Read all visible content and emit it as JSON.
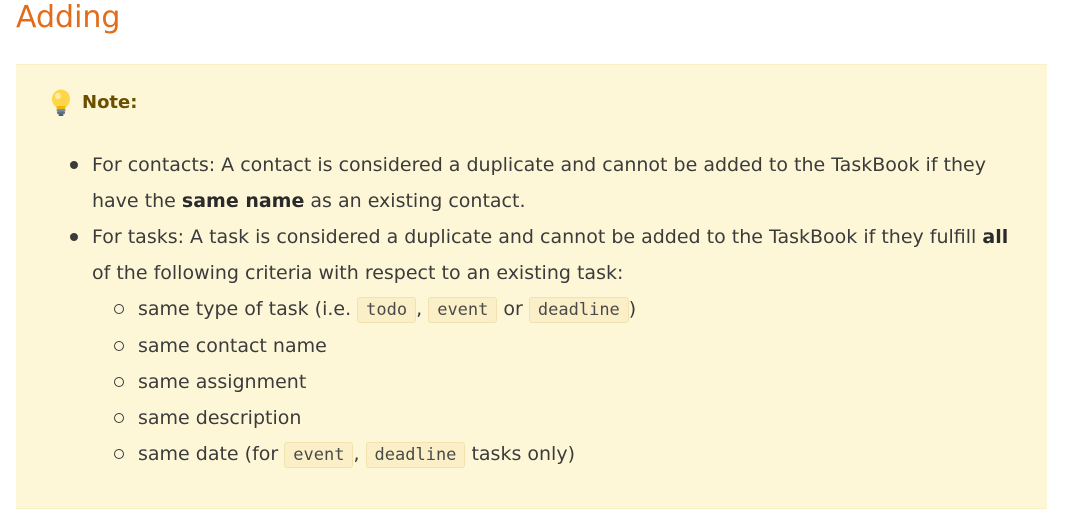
{
  "heading": "Adding",
  "note": {
    "icon": "lightbulb-icon",
    "title": "Note:",
    "colors": {
      "heading": "#e36c1b",
      "box_background": "#fef7d7",
      "code_background": "#fbefc7"
    }
  },
  "items": [
    {
      "text_before": "For contacts: A contact is considered a duplicate and cannot be added to the TaskBook if they have the ",
      "bold": "same name",
      "text_after": " as an existing contact."
    },
    {
      "text_before": "For tasks: A task is considered a duplicate and cannot be added to the TaskBook if they fulfill ",
      "bold": "all",
      "text_after": " of the following criteria with respect to an existing task:",
      "sub": {
        "type_prefix": "same type of task (i.e. ",
        "code_todo": "todo",
        "sep1": ",",
        "code_event": "event",
        "or": " or ",
        "code_deadline": "deadline",
        "type_suffix": ")",
        "contact_name": "same contact name",
        "assignment": "same assignment",
        "description": "same description",
        "date_prefix": "same date (for ",
        "date_code_event": "event",
        "date_sep": ",",
        "date_code_deadline": "deadline",
        "date_suffix": " tasks only)"
      }
    }
  ]
}
